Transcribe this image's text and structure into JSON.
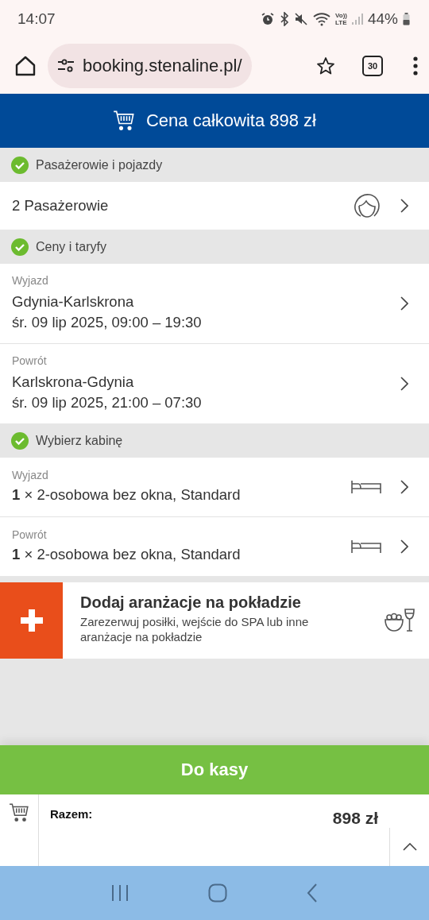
{
  "status_bar": {
    "time": "14:07",
    "volte_top": "Vo))",
    "volte_bottom": "LTE",
    "battery": "44%"
  },
  "browser": {
    "url": "booking.stenaline.pl/",
    "tab_count": "30"
  },
  "header": {
    "total": "Cena całkowita 898 zł"
  },
  "sections": [
    {
      "title": "Pasażerowie i pojazdy",
      "done": true,
      "items": [
        {
          "kind": "passengers",
          "text": "2 Pasażerowie"
        }
      ]
    },
    {
      "title": "Ceny i taryfy",
      "done": true,
      "items": [
        {
          "kind": "trip",
          "label": "Wyjazd",
          "route": "Gdynia-Karlskrona",
          "datetime": "śr. 09 lip 2025, 09:00 – 19:30"
        },
        {
          "kind": "trip",
          "label": "Powrót",
          "route": "Karlskrona-Gdynia",
          "datetime": "śr. 09 lip 2025, 21:00 – 07:30"
        }
      ]
    },
    {
      "title": "Wybierz kabinę",
      "done": true,
      "items": [
        {
          "kind": "cabin",
          "label": "Wyjazd",
          "text": "**1** × 2-osobowa bez okna, Standard"
        },
        {
          "kind": "cabin",
          "label": "Powrót",
          "text": "**1** × 2-osobowa bez okna, Standard"
        }
      ]
    }
  ],
  "addon": {
    "title": "Dodaj aranżacje na pokładzie",
    "description": "Zarezerwuj posiłki, wejście do SPA lub inne aranżacje na pokładzie"
  },
  "checkout": {
    "button": "Do kasy"
  },
  "summary": {
    "label": "Razem:",
    "total": "898 zł"
  }
}
